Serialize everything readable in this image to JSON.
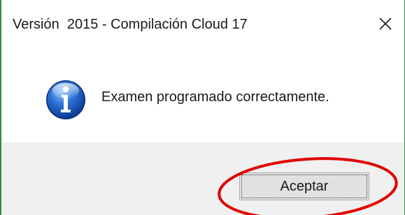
{
  "window": {
    "title": "Versión  2015 - Compilación Cloud 17",
    "close_icon": "close-icon",
    "accent_color": "#2f8f3e"
  },
  "content": {
    "icon": "info-icon",
    "message": "Examen programado correctamente."
  },
  "footer": {
    "ok_label": "Aceptar"
  },
  "annotation": {
    "shape": "ellipse",
    "color": "#e00000",
    "target": "ok-button"
  }
}
